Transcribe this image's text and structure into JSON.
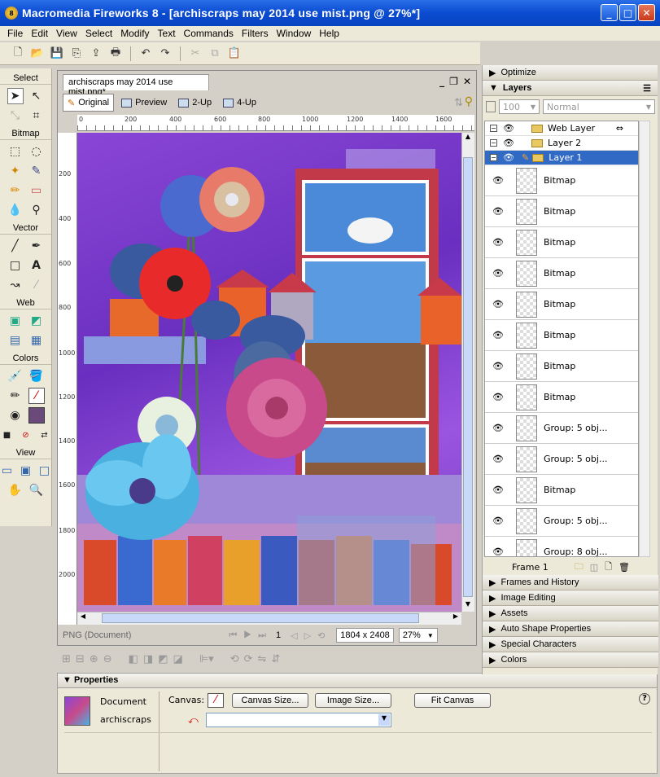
{
  "window": {
    "title": "Macromedia Fireworks 8 - [archiscraps may 2014 use mist.png @  27%*]"
  },
  "menu": [
    "File",
    "Edit",
    "View",
    "Select",
    "Modify",
    "Text",
    "Commands",
    "Filters",
    "Window",
    "Help"
  ],
  "tools": {
    "sections": [
      "Select",
      "Bitmap",
      "Vector",
      "Web",
      "Colors",
      "View"
    ]
  },
  "document": {
    "tab": "archiscraps may 2014 use mist.png*",
    "views": [
      "Original",
      "Preview",
      "2-Up",
      "4-Up"
    ],
    "ruler_h": [
      "0",
      "200",
      "400",
      "600",
      "800",
      "1000",
      "1200",
      "1400",
      "1600"
    ],
    "ruler_v": [
      "200",
      "400",
      "600",
      "800",
      "1000",
      "1200",
      "1400",
      "1600",
      "1800",
      "2000"
    ],
    "status_type": "PNG (Document)",
    "frame": "1",
    "size": "1804 x 2408",
    "zoom": "27%"
  },
  "properties": {
    "title": "Properties",
    "doc_label": "Document",
    "doc_name": "archiscraps",
    "canvas_label": "Canvas:",
    "canvas_size_btn": "Canvas Size...",
    "image_size_btn": "Image Size...",
    "fit_canvas_btn": "Fit Canvas",
    "help": "?"
  },
  "panels": {
    "optimize": "Optimize",
    "layers": "Layers",
    "opacity": "100",
    "blend": "Normal",
    "layer_rows": [
      {
        "name": "Web Layer"
      },
      {
        "name": "Layer 2"
      },
      {
        "name": "Layer 1"
      }
    ],
    "objects": [
      "Bitmap",
      "Bitmap",
      "Bitmap",
      "Bitmap",
      "Bitmap",
      "Bitmap",
      "Bitmap",
      "Bitmap",
      "Group: 5 obj...",
      "Group: 5 obj...",
      "Bitmap",
      "Group: 5 obj...",
      "Group: 8 obj..."
    ],
    "frame_label": "Frame 1",
    "collapsed": [
      "Frames and History",
      "Image Editing",
      "Assets",
      "Auto Shape Properties",
      "Special Characters",
      "Colors"
    ]
  }
}
